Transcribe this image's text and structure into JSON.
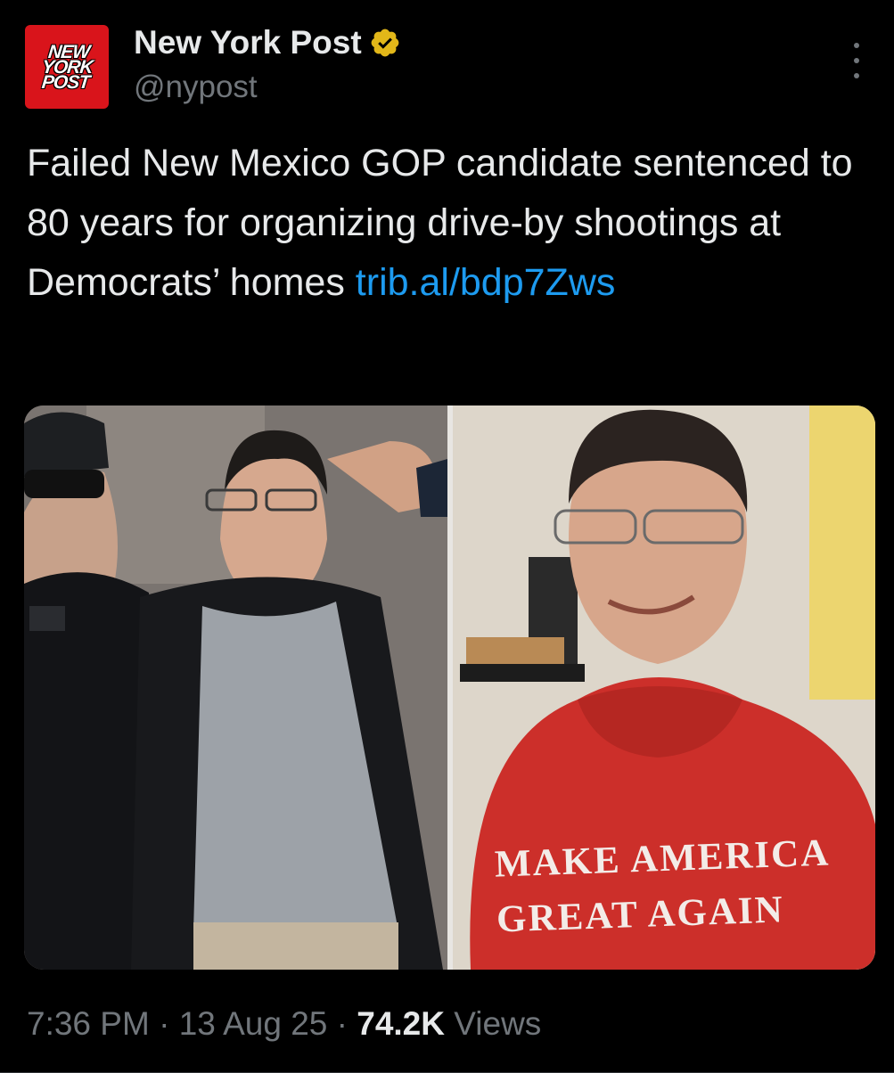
{
  "author": {
    "name": "New York Post",
    "handle": "@nypost",
    "avatar_logo": "NEW\nYORK\nPOST",
    "verified": true,
    "verified_badge_color": "#e2b719",
    "avatar_color": "#d9141b"
  },
  "tweet": {
    "text": "Failed New Mexico GOP candidate sentenced to 80 years for organizing drive-by shootings at Democrats’ homes ",
    "link": "trib.al/bdp7Zws",
    "link_color": "#1d9bf0"
  },
  "media": {
    "photos": [
      {
        "subject": "man in gray t-shirt escorted by officers"
      },
      {
        "subject": "man in red hoodie smiling",
        "shirt_text": [
          "MAKE AMERICA",
          "GREAT AGAIN"
        ]
      }
    ]
  },
  "meta": {
    "time": "7:36 PM",
    "separator": " · ",
    "date": "13 Aug 25",
    "views_count": "74.2K",
    "views_label": " Views"
  },
  "icons": {
    "more": "more-vertical-icon",
    "verified": "verified-badge-icon"
  }
}
